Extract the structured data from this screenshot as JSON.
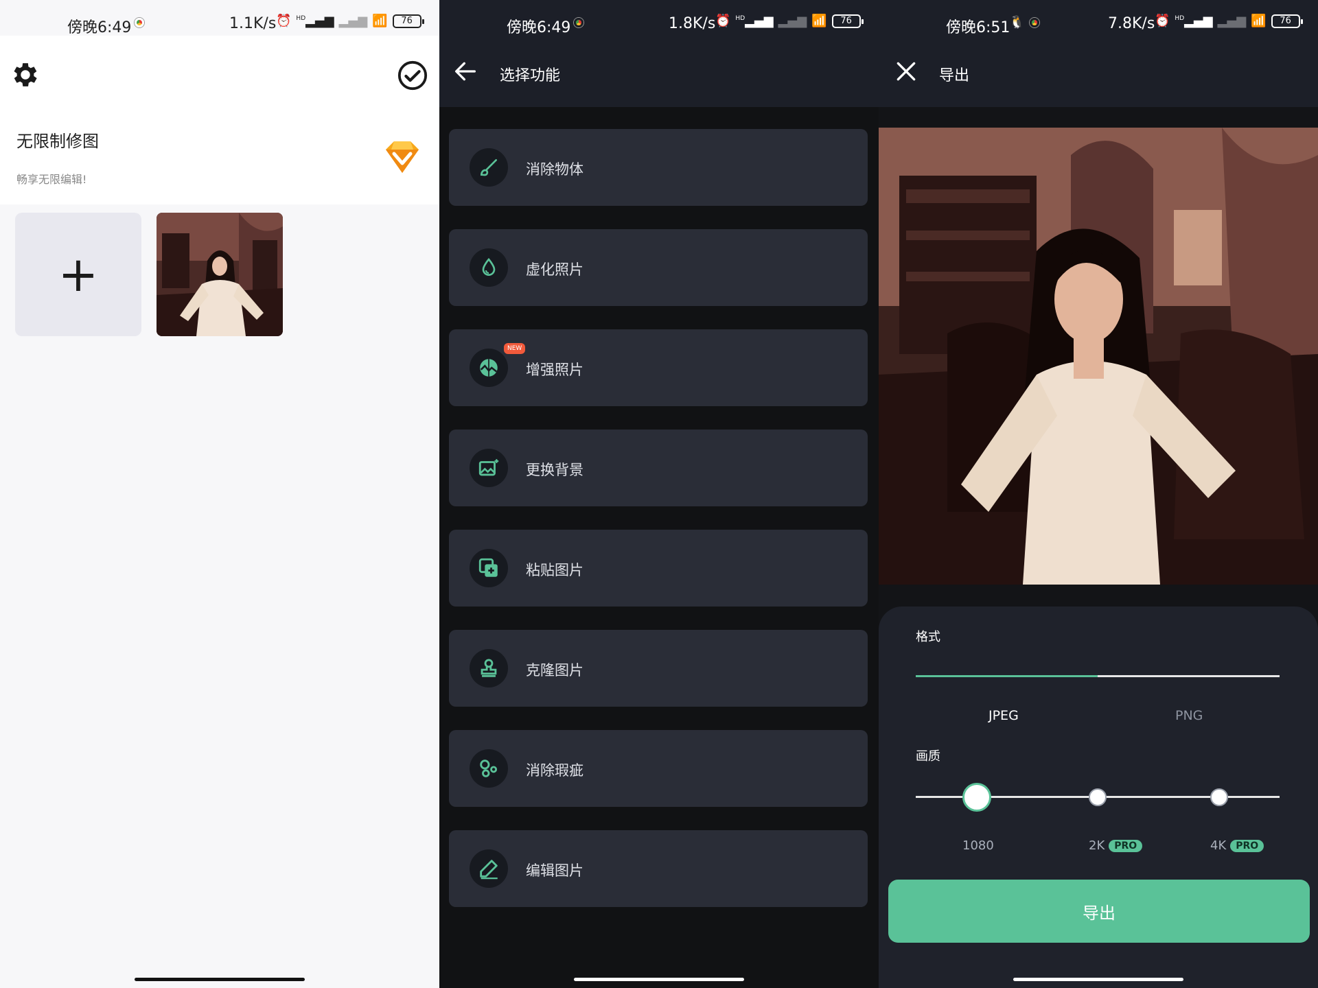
{
  "colors": {
    "accent": "#5ac298",
    "dark_bg": "#111214",
    "dark_bar": "#1c1f28",
    "card": "#2a2d37",
    "new_badge": "#f25a3b",
    "gem": "#f7a81b"
  },
  "screens": [
    {
      "status": {
        "time": "傍晚6:49",
        "speed": "1.1K/s",
        "hd": "HD",
        "battery": "76"
      },
      "settings_icon": "gear-icon",
      "confirm_icon": "check-circle-icon",
      "promo": {
        "title": "无限制修图",
        "subtitle": "畅享无限编辑!",
        "icon": "diamond-icon"
      },
      "add_tile": {
        "symbol": "+"
      }
    },
    {
      "status": {
        "time": "傍晚6:49",
        "speed": "1.8K/s",
        "hd": "HD",
        "battery": "76"
      },
      "header": {
        "title": "选择功能",
        "back_icon": "arrow-left-icon"
      },
      "tools": [
        {
          "label": "消除物体",
          "icon": "brush-icon"
        },
        {
          "label": "虚化照片",
          "icon": "droplet-icon"
        },
        {
          "label": "增强照片",
          "icon": "enhance-icon",
          "badge": "NEW"
        },
        {
          "label": "更换背景",
          "icon": "image-sparkle-icon"
        },
        {
          "label": "粘贴图片",
          "icon": "paste-image-icon"
        },
        {
          "label": "克隆图片",
          "icon": "stamp-icon"
        },
        {
          "label": "消除瑕疵",
          "icon": "blemish-icon"
        },
        {
          "label": "编辑图片",
          "icon": "pen-edit-icon"
        }
      ]
    },
    {
      "status": {
        "time": "傍晚6:51",
        "speed": "7.8K/s",
        "hd": "HD",
        "battery": "76"
      },
      "header": {
        "title": "导出",
        "close_icon": "close-icon"
      },
      "format": {
        "label": "格式",
        "options": [
          "JPEG",
          "PNG"
        ],
        "selected": "JPEG"
      },
      "quality": {
        "label": "画质",
        "options": [
          {
            "label": "1080",
            "pro": ""
          },
          {
            "label": "2K",
            "pro": "PRO"
          },
          {
            "label": "4K",
            "pro": "PRO"
          }
        ],
        "selected": "1080"
      },
      "export_button": "导出"
    }
  ]
}
